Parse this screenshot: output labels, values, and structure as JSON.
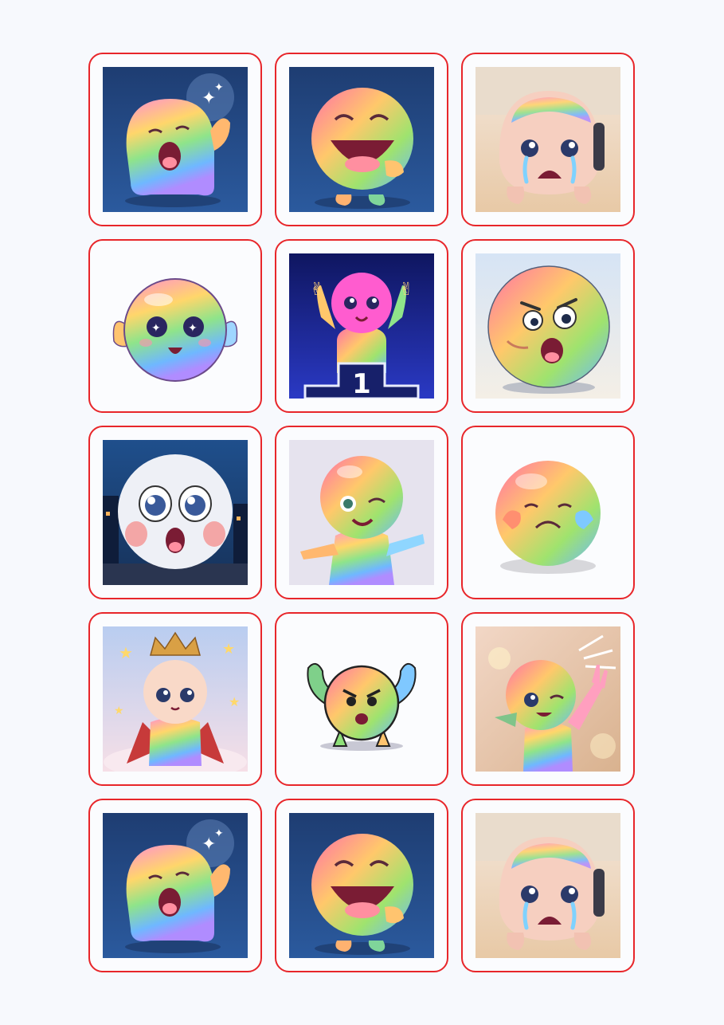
{
  "sticker_sheet": {
    "border_color": "#e8262a",
    "page_background": "#f7f9fd",
    "stickers": [
      {
        "name": "yawning-sparkle-blob-icon"
      },
      {
        "name": "laughing-blob-icon"
      },
      {
        "name": "crying-blob-icon"
      },
      {
        "name": "starry-eyed-blob-icon"
      },
      {
        "name": "victory-podium-blob-icon",
        "label": "1"
      },
      {
        "name": "shocked-angry-blob-icon"
      },
      {
        "name": "surprised-night-blob-icon"
      },
      {
        "name": "winking-blob-icon"
      },
      {
        "name": "worried-ball-icon"
      },
      {
        "name": "crowned-king-blob-icon"
      },
      {
        "name": "angry-flexing-blob-icon"
      },
      {
        "name": "waving-wink-blob-icon"
      },
      {
        "name": "yawning-sparkle-blob-icon"
      },
      {
        "name": "laughing-blob-icon"
      },
      {
        "name": "crying-blob-icon"
      }
    ]
  }
}
